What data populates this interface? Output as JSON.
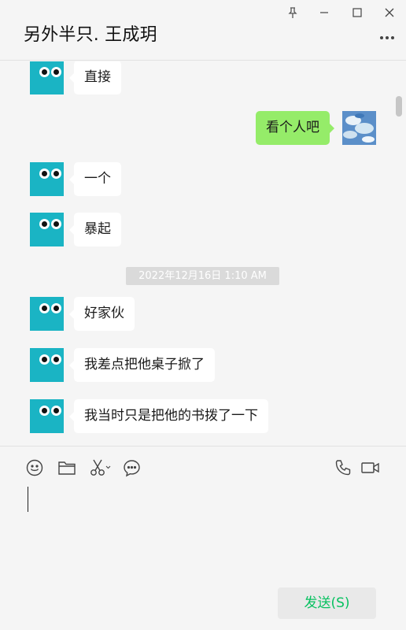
{
  "header": {
    "title": "另外半只. 王成玥"
  },
  "window_controls": [
    "pin-icon",
    "minimize-icon",
    "maximize-icon",
    "close-icon"
  ],
  "messages": [
    {
      "side": "left",
      "text": "直接"
    },
    {
      "side": "right",
      "text": "看个人吧"
    },
    {
      "side": "left",
      "text": "一个"
    },
    {
      "side": "left",
      "text": "暴起"
    },
    {
      "side": "left",
      "text": "好家伙"
    },
    {
      "side": "left",
      "text": "我差点把他桌子掀了"
    },
    {
      "side": "left",
      "text": "我当时只是把他的书拨了一下"
    }
  ],
  "timestamp": "2022年12月16日 1:10 AM",
  "toolbar": {
    "left_icons": [
      "emoji-icon",
      "folder-icon",
      "scissors-icon",
      "chat-bubble-icon"
    ],
    "right_icons": [
      "phone-icon",
      "video-call-icon"
    ]
  },
  "send_label": "发送(S)",
  "colors": {
    "self_bubble": "#95ec69",
    "other_bubble": "#ffffff",
    "avatar": "#1ab4c4",
    "send_text": "#07c160",
    "background": "#f5f5f5"
  }
}
